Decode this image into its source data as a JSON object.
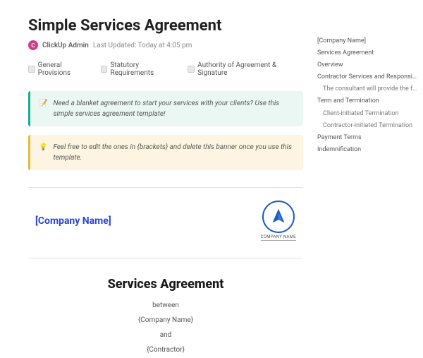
{
  "doc": {
    "title": "Simple Services Agreement",
    "author": "ClickUp Admin",
    "avatar_initial": "C",
    "last_updated": "Last Updated: Today at 4:05 pm"
  },
  "chips": [
    {
      "label": "General Provisions"
    },
    {
      "label": "Statutory Requirements"
    },
    {
      "label": "Authority of Agreement & Signature"
    }
  ],
  "callouts": {
    "green": {
      "emoji": "📝",
      "text": "Need a blanket agreement to start your services with your clients? Use this simple services agreement template!"
    },
    "yellow": {
      "emoji": "💡",
      "text": "Feel free to edit the ones in {brackets} and delete this banner once you use this template."
    }
  },
  "company": {
    "placeholder": "[Company Name]",
    "logo_label": "COMPANY NAME"
  },
  "agreement": {
    "heading": "Services Agreement",
    "line1": "between",
    "line2": "{Company Name}",
    "line3": "and",
    "line4": "{Contractor}"
  },
  "toc": [
    {
      "label": "[Company Name]",
      "lvl": 0
    },
    {
      "label": "Services Agreement",
      "lvl": 0
    },
    {
      "label": "Overview",
      "lvl": 0
    },
    {
      "label": "Contractor Services and Responsibilities",
      "lvl": 0
    },
    {
      "label": "The consultant will provide the follow...",
      "lvl": 1
    },
    {
      "label": "Term and Termination",
      "lvl": 0
    },
    {
      "label": "Client-initiated Termination",
      "lvl": 1
    },
    {
      "label": "Contractor-initiated Termination",
      "lvl": 1
    },
    {
      "label": "Payment Terms",
      "lvl": 0
    },
    {
      "label": "Indemnification",
      "lvl": 0
    }
  ]
}
